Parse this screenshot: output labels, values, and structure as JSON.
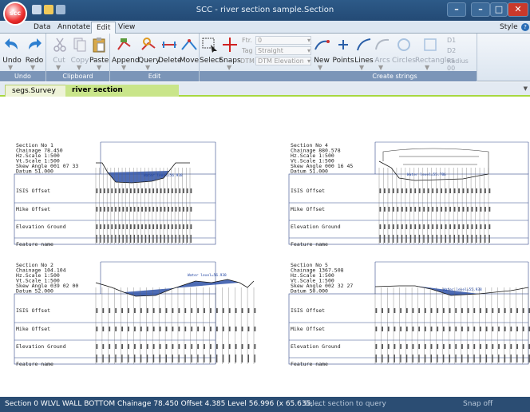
{
  "window": {
    "title": "SCC - river section sample.Section"
  },
  "app": {
    "logo_text": "scc"
  },
  "menu": {
    "tabs": [
      "Data",
      "Annotate",
      "Edit",
      "View"
    ],
    "active": "Edit",
    "right": "Style"
  },
  "ribbon": {
    "undo_group": {
      "label": "Undo",
      "undo": "Undo",
      "redo": "Redo"
    },
    "clipboard_group": {
      "label": "Clipboard",
      "cut": "Cut",
      "copy": "Copy",
      "paste": "Paste"
    },
    "edit_group": {
      "label": "Edit",
      "append": "Append",
      "query": "Query",
      "delete": "Delete",
      "move": "Move"
    },
    "snaps_group": {
      "select": "Select",
      "snaps": "Snaps"
    },
    "fields": {
      "ftr_label": "Ftr.",
      "ftr_value": "0",
      "tag_label": "Tag",
      "tag_value": "Straight",
      "dtm_label": "DTM",
      "dtm_value": "DTM Elevation"
    },
    "create_group": {
      "label": "Create strings",
      "new": "New",
      "points": "Points",
      "lines": "Lines",
      "arcs": "Arcs",
      "circles": "Circles",
      "rectangles": "Rectangles",
      "d1": "D1",
      "d2": "D2",
      "radius_label": "Radius",
      "radius_value": "00"
    }
  },
  "doc_tabs": {
    "tab1": "segs.Survey",
    "tab2": "river section sample.Section"
  },
  "sections": [
    {
      "lines": [
        "Section No 1",
        "Chainage 78.450",
        "Hz.Scale 1:500",
        "Vt.Scale 1:500",
        "Skew Angle 001 07 33",
        "Datum 51.000"
      ],
      "water": "Water level=56.938"
    },
    {
      "lines": [
        "Section No 4",
        "Chainage 880.578",
        "Hz.Scale 1:500",
        "Vt.Scale 1:500",
        "Skew Angle 000 16 45",
        "Datum 51.000"
      ],
      "water": "Water level=55.786"
    },
    {
      "lines": [
        "Section No 2",
        "Chainage 104.104",
        "Hz.Scale 1:500",
        "Vt.Scale 1:500",
        "Skew Angle 039 02 00",
        "Datum 52.000"
      ],
      "water": "Water level=56.938"
    },
    {
      "lines": [
        "Section No 5",
        "Chainage 1367.508",
        "Hz.Scale 1:500",
        "Vt.Scale 1:500",
        "Skew Angle 002 32 27",
        "Datum 50.000"
      ],
      "water": "Water level=55.938"
    }
  ],
  "row_labels": [
    "ISIS Offset",
    "Mike Offset",
    "Elevation Ground",
    "Feature name"
  ],
  "status": {
    "info": "Section 0 WLVL WALL BOTTOM Chainage 78.450 Offset 4.385 Level 56.996  (x 65.635, ...",
    "prompt": "Select section to query",
    "snap": "Snap off"
  }
}
